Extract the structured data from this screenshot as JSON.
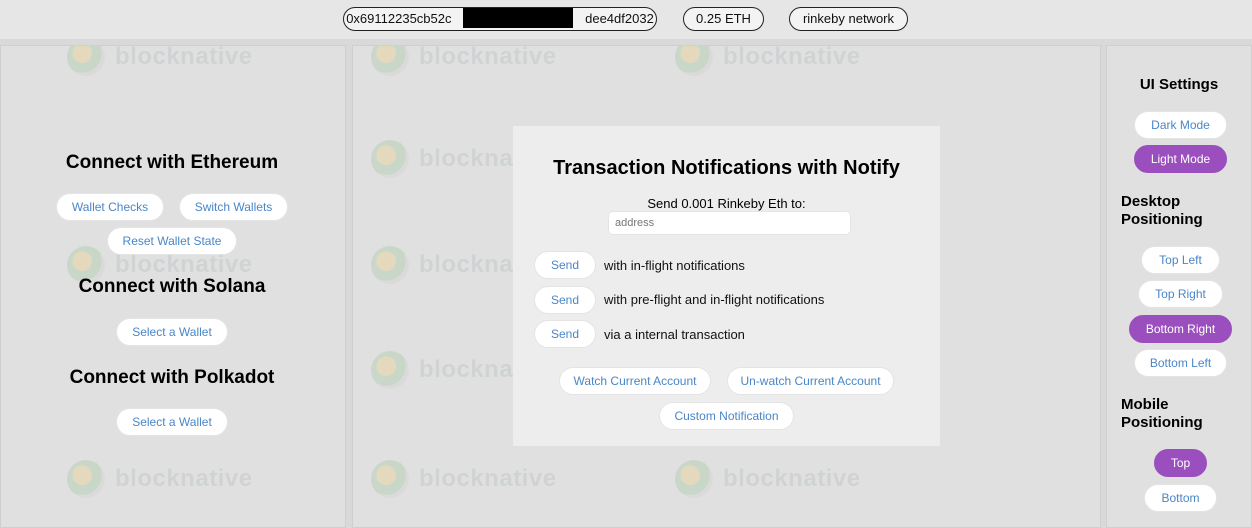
{
  "topbar": {
    "address": "0x69112235cb52c                                     dee4df2032",
    "balance": "0.25 ETH",
    "network": "rinkeby network"
  },
  "watermark": {
    "text": "blocknative"
  },
  "left": {
    "ethereum_title": "Connect with Ethereum",
    "wallet_checks": "Wallet Checks",
    "switch_wallets": "Switch Wallets",
    "reset_wallet_state": "Reset Wallet State",
    "solana_title": "Connect with Solana",
    "solana_select": "Select a Wallet",
    "polkadot_title": "Connect with Polkadot",
    "polkadot_select": "Select a Wallet"
  },
  "notify": {
    "title": "Transaction Notifications with Notify",
    "subtitle": "Send 0.001 Rinkeby Eth to:",
    "address_placeholder": "address",
    "rows": [
      {
        "button": "Send",
        "label": "with in-flight notifications"
      },
      {
        "button": "Send",
        "label": "with pre-flight and in-flight notifications"
      },
      {
        "button": "Send",
        "label": "via a internal transaction"
      }
    ],
    "watch_current": "Watch Current Account",
    "unwatch_current": "Un-watch Current Account",
    "custom_notification": "Custom Notification"
  },
  "settings": {
    "title": "UI Settings",
    "dark_mode": "Dark Mode",
    "light_mode": "Light Mode",
    "desktop_title": "Desktop Positioning",
    "top_left": "Top Left",
    "top_right": "Top Right",
    "bottom_right": "Bottom Right",
    "bottom_left": "Bottom Left",
    "mobile_title": "Mobile Positioning",
    "mobile_top": "Top",
    "mobile_bottom": "Bottom"
  },
  "colors": {
    "accent": "#9b4fbe",
    "link": "#4a86c8"
  }
}
